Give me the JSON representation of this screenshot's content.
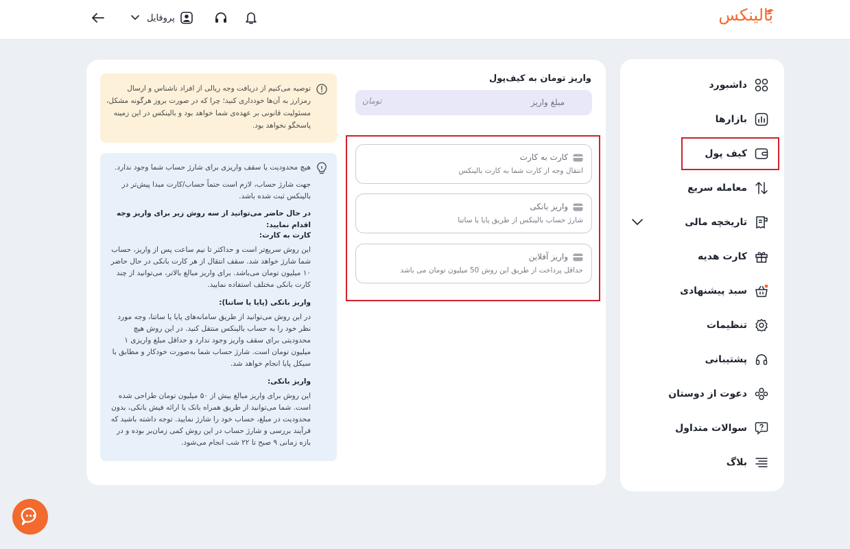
{
  "header": {
    "logo_text": "بالینکس",
    "profile_label": "پروفایل",
    "icons": [
      "back-arrow-icon",
      "chevron-down-icon",
      "user-icon",
      "headset-icon",
      "bell-icon"
    ]
  },
  "sidebar": {
    "items": [
      {
        "label": "داشبورد",
        "icon": "dashboard-icon"
      },
      {
        "label": "بازارها",
        "icon": "chart-icon"
      },
      {
        "label": "کیف پول",
        "icon": "wallet-icon",
        "active": true
      },
      {
        "label": "معامله سریع",
        "icon": "swap-icon"
      },
      {
        "label": "تاریخچه مالی",
        "icon": "receipt-icon",
        "expandable": true
      },
      {
        "label": "کارت هدیه",
        "icon": "gift-icon"
      },
      {
        "label": "سبد پیشنهادی",
        "icon": "basket-icon"
      },
      {
        "label": "تنظیمات",
        "icon": "gear-icon"
      },
      {
        "label": "پشتیبانی",
        "icon": "headset-icon"
      },
      {
        "label": "دعوت از دوستان",
        "icon": "users-icon"
      },
      {
        "label": "سوالات متداول",
        "icon": "question-icon"
      },
      {
        "label": "بلاگ",
        "icon": "menu-icon"
      }
    ]
  },
  "deposit": {
    "title": "واریز تومان به کیف‌پول",
    "amount_placeholder": "مبلغ واریز",
    "unit": "تومان",
    "methods": [
      {
        "title": "کارت به کارت",
        "subtitle": "انتقال وجه از کارت شما به کارت بالینکس"
      },
      {
        "title": "واریز بانکی",
        "subtitle": "شارژ حساب بالینکس از طریق پایا یا ساتنا"
      },
      {
        "title": "واریز آفلاین",
        "subtitle": "حداقل پرداخت از طریق این روش 50 میلیون تومان می باشد"
      }
    ]
  },
  "warning": {
    "text": "توصیه می‌کنیم از دریافت وجه ریالی از افراد ناشناس و ارسال رمزارز به آن‌ها خودداری کنید؛ چرا که در صورت بروز هرگونه مشکل، مسئولیت قانونی بر عهده‌ی شما خواهد بود و بالینکس در این زمینه پاسخگو نخواهد بود."
  },
  "info": {
    "line1": "هیچ محدودیت یا سقف واریزی برای شارژ حساب شما وجود ندارد.",
    "line2": "جهت شارژ حساب، لازم است حتماً حساب/کارت مبدا پیش‌تر در بالینکس ثبت شده باشد.",
    "intro": "در حال حاضر می‌توانید از سه روش زیر برای واریز وجه اقدام نمایید:",
    "sections": [
      {
        "heading": "کارت به کارت:",
        "body": "این روش سریع‌تر است و حداکثر تا نیم ساعت پس از واریز، حساب شما شارژ خواهد شد. سقف انتقال از هر کارت بانکی در حال حاضر ۱۰ میلیون تومان می‌باشد. برای واریز مبالغ بالاتر، می‌توانید از چند کارت بانکی مختلف استفاده نمایید."
      },
      {
        "heading": "واریز بانکی (پایا یا ساتنا):",
        "body": "در این روش می‌توانید از طریق سامانه‌های پایا یا ساتنا، وجه مورد نظر خود را به حساب بالینکس منتقل کنید. در این روش هیچ محدودیتی برای سقف واریز وجود ندارد و حداقل مبلغ واریزی ۱ میلیون تومان است. شارژ حساب شما به‌صورت خودکار و مطابق با سیکل پایا انجام خواهد شد."
      },
      {
        "heading": "واریز بانکی:",
        "body": "این روش برای واریز مبالغ بیش از ۵۰ میلیون تومان طراحی شده است. شما می‌توانید از طریق همراه بانک یا ارائه فیش بانکی، بدون محدودیت در مبلغ، حساب خود را شارژ نمایید. توجه داشته باشید که فرآیند بررسی و شارژ حساب در این روش کمی زمان‌بر بوده و در بازه زمانی ۹ صبح تا ۲۲ شب انجام می‌شود."
      }
    ]
  },
  "colors": {
    "brand": "#f26a2e",
    "highlight": "#d0202b",
    "warning_bg": "#fdf1d9",
    "info_bg": "#e8f1f9",
    "input_bg": "#e9e8f8"
  }
}
